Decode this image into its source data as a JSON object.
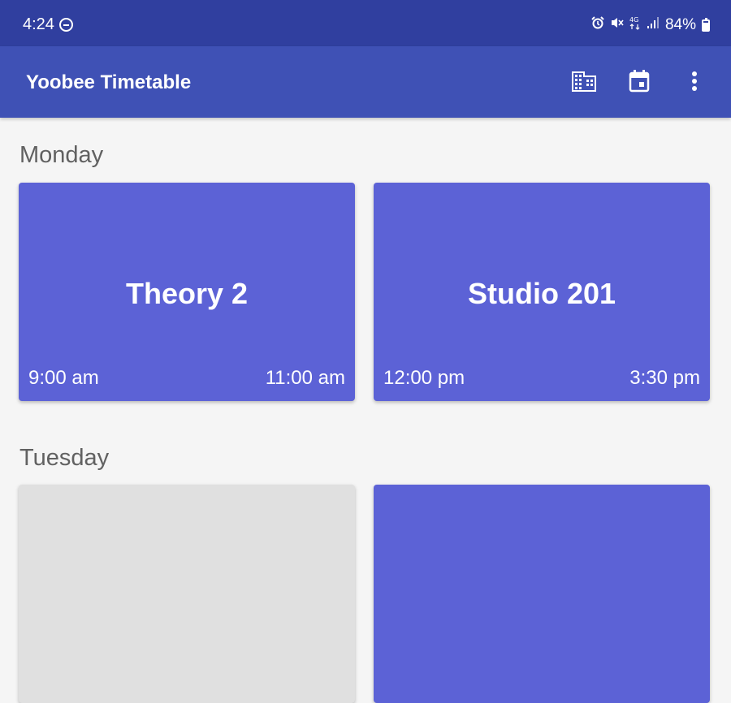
{
  "status_bar": {
    "time": "4:24",
    "battery": "84%",
    "icons": [
      "dnd-icon",
      "alarm-icon",
      "mute-icon",
      "4g-icon",
      "signal-icon",
      "battery-icon"
    ]
  },
  "app_bar": {
    "title": "Yoobee Timetable",
    "actions": [
      "building-icon",
      "calendar-icon",
      "more-vert-icon"
    ]
  },
  "days": [
    {
      "label": "Monday",
      "classes": [
        {
          "room": "Theory 2",
          "start": "9:00 am",
          "end": "11:00 am"
        },
        {
          "room": "Studio 201",
          "start": "12:00 pm",
          "end": "3:30 pm"
        }
      ]
    },
    {
      "label": "Tuesday",
      "classes": []
    }
  ],
  "colors": {
    "status_bar": "#303f9f",
    "app_bar": "#3f51b5",
    "card": "#5c62d6",
    "background": "#f5f5f5"
  }
}
